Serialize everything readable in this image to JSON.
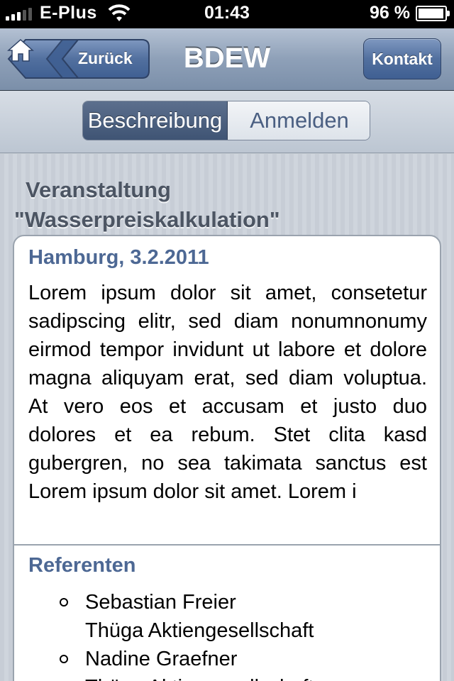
{
  "status_bar": {
    "carrier": "E-Plus",
    "time": "01:43",
    "battery": "96 %",
    "battery_level": 0.96,
    "signal_bars": 3
  },
  "nav": {
    "title": "BDEW",
    "back_label": "Zurück",
    "contact_label": "Kontakt"
  },
  "segments": [
    {
      "label": "Beschreibung",
      "selected": true
    },
    {
      "label": "Anmelden",
      "selected": false
    }
  ],
  "event": {
    "heading_line1": "Veranstaltung",
    "heading_line2": "\"Wasserpreiskalkulation\"",
    "date_location": "Hamburg, 3.2.2011",
    "description": "Lorem ipsum dolor sit amet, consetetur sadipscing elitr, sed diam nonumnonumy eirmod tempor invidunt ut labore et dolore magna aliquyam erat, sed diam voluptua. At vero eos et accusam et justo duo dolores et ea rebum. Stet clita kasd gubergren, no sea takimata sanctus est Lorem ipsum dolor sit amet. Lorem i"
  },
  "referents": {
    "title": "Referenten",
    "items": [
      {
        "name": "Sebastian Freier",
        "company": "Thüga Aktiengesellschaft"
      },
      {
        "name": "Nadine Graefner",
        "company": "Thüga Aktiengesellschaft"
      }
    ]
  },
  "colors": {
    "nav_bar": "#8ea0b8",
    "accent_blue": "#4d6894",
    "contact_button": "#52709f"
  }
}
